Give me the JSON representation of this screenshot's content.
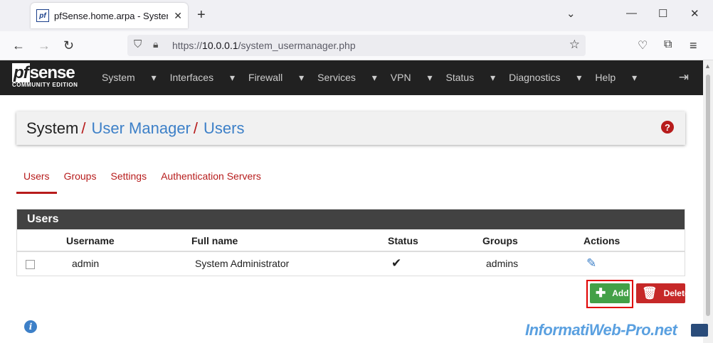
{
  "browser": {
    "tab_title": "pfSense.home.arpa - System: U",
    "tab_favicon": "pf",
    "url_prefix": "https://",
    "url_host": "10.0.0.1",
    "url_path": "/system_usermanager.php"
  },
  "pfsense": {
    "logo_main": "sense",
    "logo_pf": "pf",
    "logo_sub": "COMMUNITY EDITION",
    "menu": [
      "System",
      "Interfaces",
      "Firewall",
      "Services",
      "VPN",
      "Status",
      "Diagnostics",
      "Help"
    ]
  },
  "breadcrumb": {
    "system": "System",
    "user_manager": "User Manager",
    "users": "Users",
    "sep": "/"
  },
  "tabs": [
    "Users",
    "Groups",
    "Settings",
    "Authentication Servers"
  ],
  "panel": {
    "title": "Users",
    "columns": [
      "Username",
      "Full name",
      "Status",
      "Groups",
      "Actions"
    ],
    "rows": [
      {
        "username": "admin",
        "full_name": "System Administrator",
        "groups": "admins"
      }
    ]
  },
  "buttons": {
    "add": "Add",
    "delete": "Delete"
  },
  "watermark": "InformatiWeb-Pro.net",
  "colors": {
    "brand_red": "#b71c1c",
    "link_blue": "#3d80c8",
    "add_green": "#43a047",
    "delete_red": "#c62828",
    "nav_dark": "#212121"
  }
}
